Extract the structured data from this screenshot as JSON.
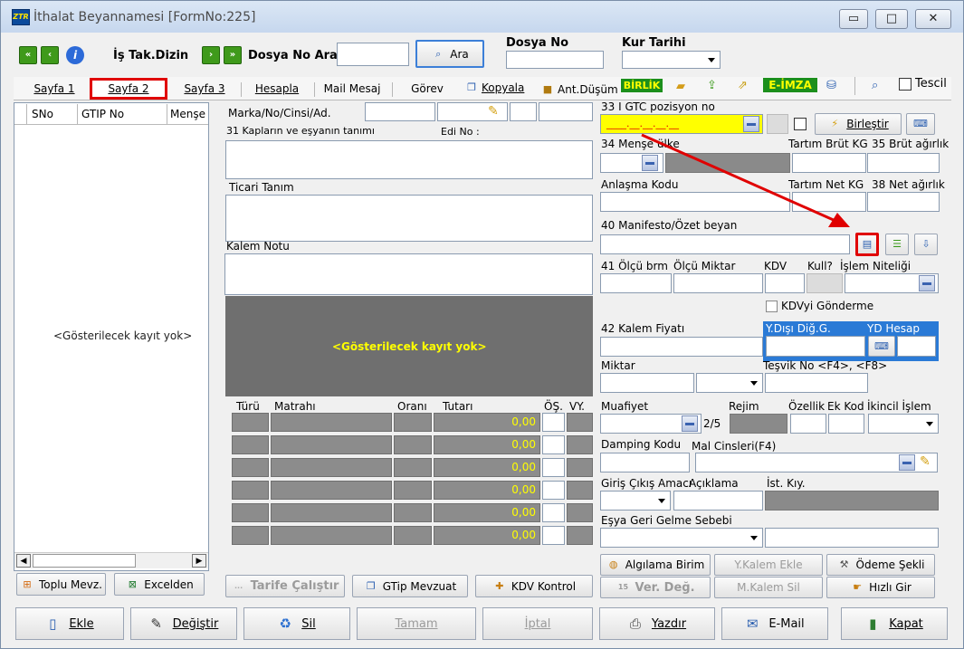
{
  "window": {
    "title": "İthalat Beyannamesi [FormNo:225]",
    "logo_text": "ZTR"
  },
  "toolbar": {
    "is_takip": "İş Tak.Dizin",
    "dosya_no_ara": "Dosya No Ara",
    "ara_button": "Ara",
    "dosya_no_label": "Dosya No",
    "kur_tarihi_label": "Kur Tarihi",
    "birlik": "BİRLİK",
    "eimza": "E-İMZA",
    "tescil": "Tescil",
    "kopyala": "Kopyala",
    "ant_dusum": "Ant.Düşüm"
  },
  "tabs": [
    "Sayfa 1",
    "Sayfa 2",
    "Sayfa 3",
    "Hesapla",
    "Mail Mesaj",
    "Görev"
  ],
  "left_grid": {
    "columns": [
      "SNo",
      "GTIP No",
      "Menşe"
    ],
    "empty_text": "<Gösterilecek kayıt yok>"
  },
  "left_buttons": {
    "toplu": "Toplu Mevz.",
    "excel": "Excelden"
  },
  "middle": {
    "marka_label": "Marka/No/Cinsi/Ad.",
    "kaplar_label": "31 Kapların ve eşyanın tanımı",
    "edi_label": "Edi No :",
    "ticari_label": "Ticari Tanım",
    "kalem_notu_label": "Kalem Notu",
    "empty_text": "<Gösterilecek kayıt yok>",
    "tax_columns": [
      "Türü",
      "Matrahı",
      "Oranı",
      "Tutarı",
      "ÖŞ.",
      "VY."
    ],
    "tax_values": [
      "0,00",
      "0,00",
      "0,00",
      "0,00",
      "0,00",
      "0,00"
    ],
    "tarife_button": "Tarife Çalıştır",
    "gtip_button": "GTip Mevzuat",
    "kdv_button": "KDV Kontrol"
  },
  "right": {
    "gtc_label": "33 I GTC pozisyon no",
    "gtc_value": "____.__.__.__.__",
    "birlestir": "Birleştir",
    "mense_label": "34 Menşe ülke",
    "tartim_brut": "Tartım Brüt KG",
    "brut_agirlik": "35 Brüt ağırlık",
    "anlasma": "Anlaşma Kodu",
    "tartim_net": "Tartım Net KG",
    "net_agirlik": "38 Net ağırlık",
    "manifesto": "40 Manifesto/Özet beyan",
    "olcu_brm": "41 Ölçü brm",
    "olcu_miktar": "Ölçü Miktar",
    "kdv": "KDV",
    "kull": "Kull?",
    "islem_niteligi": "İşlem Niteliği",
    "kdv_gonderme": "KDVyi Gönderme",
    "kalem_fiyati": "42 Kalem Fiyatı",
    "ydisi": "Y.Dışı Diğ.G.",
    "yd_hesap": "YD Hesap",
    "miktar": "Miktar",
    "tesvik": "Teşvik No <F4>, <F8>",
    "muafiyet": "Muafiyet",
    "rejim": "Rejim",
    "ozellik": "Özellik",
    "ek_kod": "Ek Kod",
    "ikincil": "İkincil İşlem",
    "page_counter": "2/5",
    "damping": "Damping Kodu",
    "mal_cinsleri": "Mal Cinsleri(F4)",
    "giris_cikis": "Giriş Çıkış Amacı",
    "aciklama": "Açıklama",
    "ist_kiy": "İst. Kıy.",
    "esya_geri": "Eşya Geri Gelme Sebebi",
    "algilama": "Algılama Birim",
    "ykalem_ekle": "Y.Kalem Ekle",
    "odeme_sekli": "Ödeme Şekli",
    "ver_deg": "Ver. Değ.",
    "mkalem_sil": "M.Kalem Sil",
    "hizli_gir": "Hızlı Gir"
  },
  "bottom": {
    "ekle": "Ekle",
    "degistir": "Değiştir",
    "sil": "Sil",
    "tamam": "Tamam",
    "iptal": "İptal",
    "yazdir": "Yazdır",
    "email": "E-Mail",
    "kapat": "Kapat"
  }
}
